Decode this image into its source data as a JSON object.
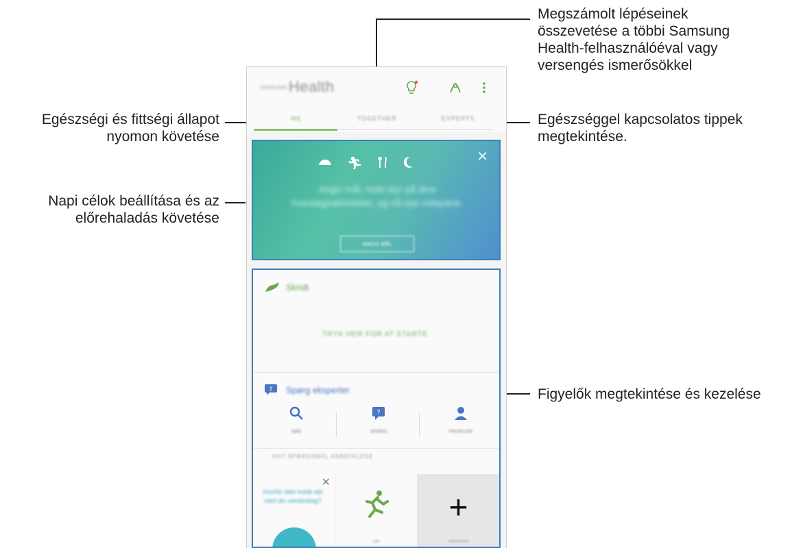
{
  "callouts": {
    "together": [
      "Megszámolt lépéseinek",
      "összevetése a többi Samsung",
      "Health-felhasználóéval vagy",
      "versengés ismerősökkel"
    ],
    "me": [
      "Egészségi és fittségi állapot",
      "nyomon követése"
    ],
    "tips": [
      "Egészséggel kapcsolatos tippek",
      "megtekintése."
    ],
    "goals": [
      "Napi célok beállítása és az",
      "előrehaladás követése"
    ],
    "trackers": "Figyelők megtekintése és kezelése"
  },
  "app": {
    "brand_small": "SAMSUNG",
    "title": "Health",
    "icons": [
      "lightbulb-icon",
      "person-icon",
      "more-vert-icon"
    ],
    "tabs": [
      "ME",
      "TOGETHER",
      "EXPERTS"
    ]
  },
  "hero": {
    "icons": [
      "shoe-icon",
      "running-icon",
      "fork-knife-icon",
      "moon-icon"
    ],
    "text": "Angiv mål, hold styr på dine hverdagsaktiviteter, og nå nye milepæle.",
    "button": "ANGIV MÅL"
  },
  "steps": {
    "label": "Skridt",
    "cta": "TRYK HER FOR AT STARTE."
  },
  "experts": {
    "label": "Spørg eksperter",
    "items": [
      "SØG",
      "SPØRG",
      "PROFILER"
    ],
    "subhead": "HOT SPØRGSMÅL   ANBEFALEDE"
  },
  "tiles": {
    "tile1_text": "Hvorfor ikke holde øje med din vandindtag?",
    "tile2_label": "Løb",
    "tile3_label": "Administrer"
  },
  "colors": {
    "accent_green": "#8dc06a",
    "annotation_blue": "#3f7fb8"
  }
}
